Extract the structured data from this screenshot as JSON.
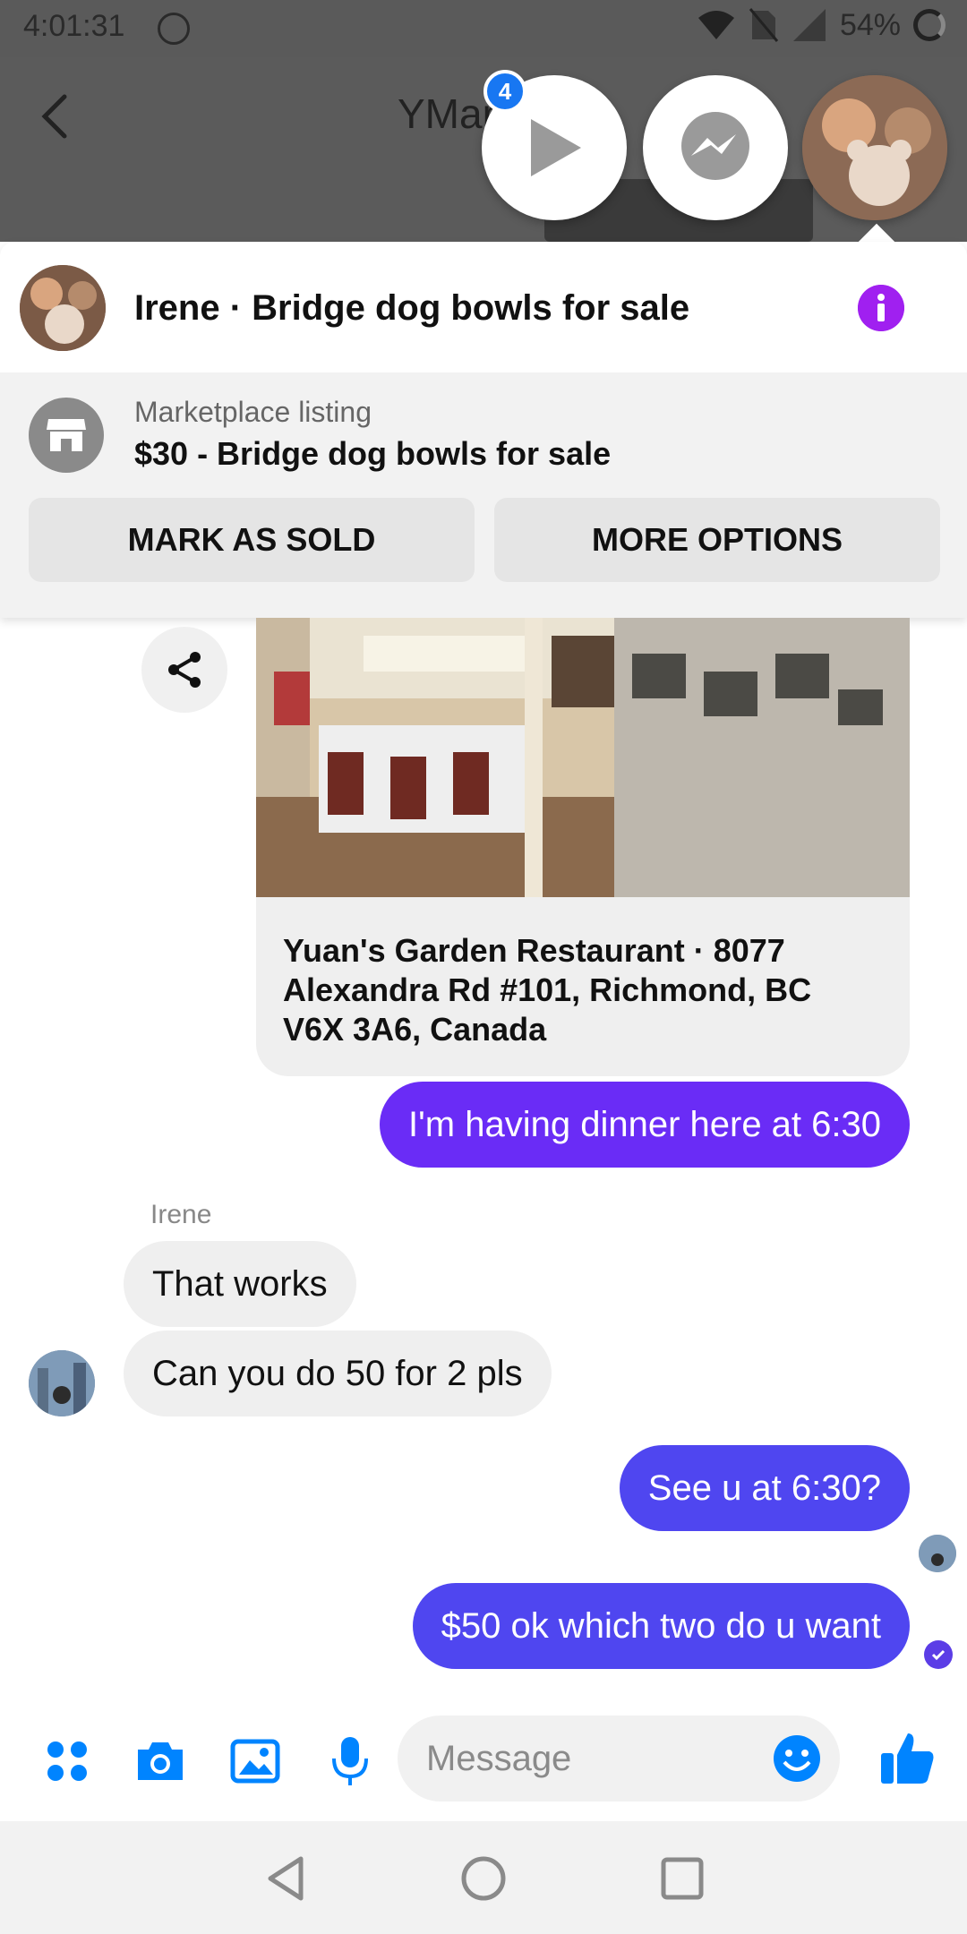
{
  "status_bar": {
    "time": "4:01:31",
    "battery": "54%"
  },
  "header": {
    "title": "YMar"
  },
  "chat_heads": {
    "badge_count": "4"
  },
  "listing_card": {
    "title": "Irene · Bridge dog bowls for sale",
    "label": "Marketplace listing",
    "price_title": "$30 - Bridge dog bowls for sale",
    "mark_sold": "MARK AS SOLD",
    "more_options": "MORE OPTIONS"
  },
  "location": {
    "text": "Yuan's Garden Restaurant · 8077 Alexandra Rd #101, Richmond, BC V6X 3A6, Canada"
  },
  "messages": [
    {
      "sender": "me",
      "text": "I'm having dinner here at 6:30"
    },
    {
      "sender": "other",
      "text": "That works"
    },
    {
      "sender": "other",
      "text": "Can you do 50 for 2 pls"
    },
    {
      "sender": "me",
      "text": "See u at 6:30?"
    },
    {
      "sender": "me",
      "text": "$50 ok which two do u want"
    }
  ],
  "sender_name": "Irene",
  "composer": {
    "placeholder": "Message"
  },
  "colors": {
    "accent": "#0084ff",
    "my_bubble": "#6a2cf6",
    "info": "#a020f0"
  }
}
